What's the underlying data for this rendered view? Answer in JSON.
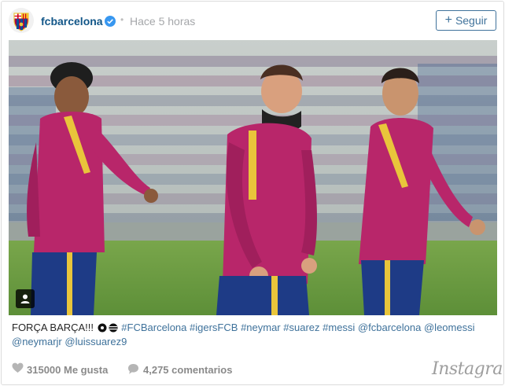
{
  "post": {
    "username": "fcbarcelona",
    "time_separator": "•",
    "timestamp": "Hace 5 horas",
    "follow_label": "Seguir",
    "follow_plus": "+"
  },
  "caption": {
    "text": "FORÇA BARÇA!!!",
    "hashtags": [
      "#FCBarcelona",
      "#igersFCB",
      "#neymar",
      "#suarez",
      "#messi"
    ],
    "mentions": [
      "@fcbarcelona",
      "@leomessi",
      "@neymarjr",
      "@luissuarez9"
    ]
  },
  "stats": {
    "likes": "315000 Me gusta",
    "comments": "4,275 comentarios"
  },
  "brand": {
    "logo_text": "Instagram"
  },
  "icons": {
    "avatar": "fc-barcelona-crest",
    "verified": "verified-badge-icon",
    "user_tag": "user-icon",
    "like": "heart-icon",
    "comment": "comment-bubble-icon",
    "emoji": "soccer-ball-emoji"
  },
  "colors": {
    "link": "#3f729b",
    "username": "#125688",
    "muted": "#a5a7aa",
    "jersey": "#b8266a",
    "stripe": "#e9c53b",
    "shorts": "#1e3b86"
  }
}
